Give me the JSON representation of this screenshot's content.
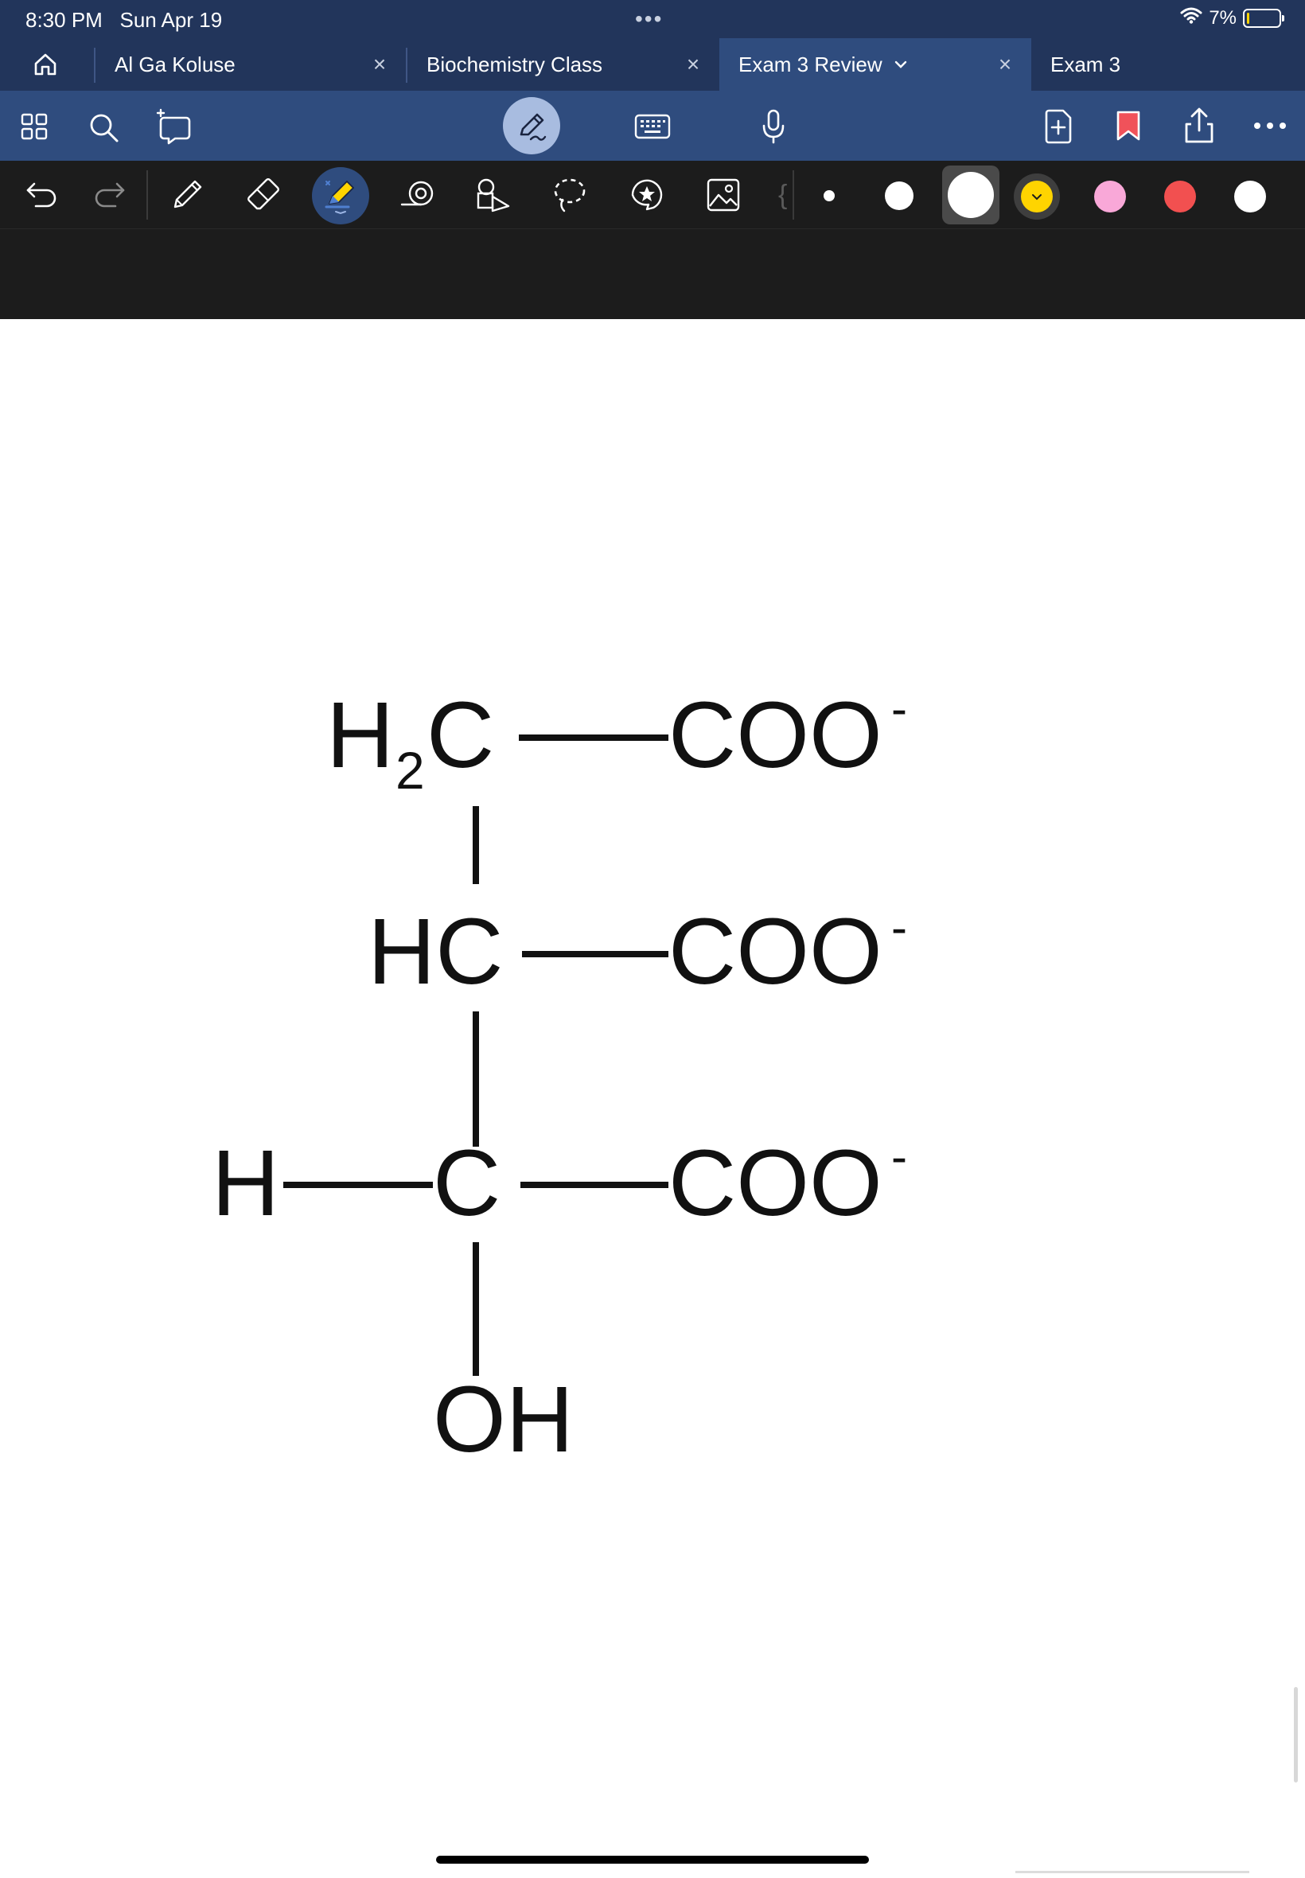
{
  "status_bar": {
    "time": "8:30 PM",
    "date": "Sun Apr 19",
    "battery": "7%",
    "battery_fraction": 0.07
  },
  "tabs": [
    {
      "label": "Al Ga Koluse",
      "active": false
    },
    {
      "label": "Biochemistry Class",
      "active": false
    },
    {
      "label": "Exam 3 Review",
      "active": true
    },
    {
      "label": "Exam 3",
      "active": false
    }
  ],
  "main_toolbar": {
    "icons": [
      "grid-icon",
      "search-icon",
      "add-sticky-icon",
      "pen-mode-icon",
      "keyboard-icon",
      "microphone-icon",
      "add-page-icon",
      "bookmark-icon",
      "share-icon",
      "more-icon"
    ]
  },
  "pen_toolbar": {
    "tools": [
      "undo-icon",
      "redo-icon",
      "pencil-icon",
      "eraser-icon",
      "highlighter-icon",
      "tape-icon",
      "shapes-icon",
      "lasso-icon",
      "sticker-icon",
      "image-icon"
    ],
    "color_swatches": [
      "#ffffff",
      "#ffffff",
      "#ffffff",
      "#ffd400",
      "#f9a8d8",
      "#f25050",
      "#ffffff"
    ],
    "selected_color": "#ffd400",
    "accent": "#ffd400"
  },
  "molecule": {
    "row1_left": "H",
    "row1_sub": "2",
    "row1_c": "C",
    "row1_right": "COO",
    "row2_left": "HC",
    "row2_right": "COO",
    "row3_h": "H",
    "row3_c": "C",
    "row3_right": "COO",
    "charge": "-",
    "bottom": "OH"
  },
  "colors": {
    "status_bg": "#22355b",
    "toolbar_bg": "#2f4c7e",
    "pen_toolbar_bg": "#1c1c1c",
    "bookmark": "#f0525a"
  }
}
